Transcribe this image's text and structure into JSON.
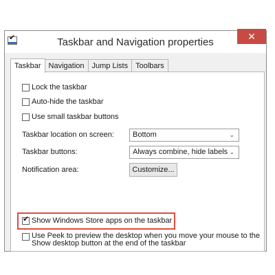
{
  "window": {
    "title": "Taskbar and Navigation properties",
    "close_glyph": "✕"
  },
  "tabs": [
    {
      "label": "Taskbar",
      "active": true
    },
    {
      "label": "Navigation",
      "active": false
    },
    {
      "label": "Jump Lists",
      "active": false
    },
    {
      "label": "Toolbars",
      "active": false
    }
  ],
  "taskbar": {
    "lock": {
      "label": "Lock the taskbar",
      "checked": false
    },
    "autohide": {
      "label": "Auto-hide the taskbar",
      "checked": false
    },
    "small_buttons": {
      "label": "Use small taskbar buttons",
      "checked": false
    },
    "location": {
      "label": "Taskbar location on screen:",
      "value": "Bottom"
    },
    "buttons": {
      "label": "Taskbar buttons:",
      "value": "Always combine, hide labels"
    },
    "notification": {
      "label": "Notification area:",
      "button": "Customize..."
    },
    "store_apps": {
      "label": "Show Windows Store apps on the taskbar",
      "checked": true
    },
    "peek": {
      "line1": "Use Peek to preview the desktop when you move your mouse to the",
      "line2": "Show desktop button at the end of the taskbar",
      "checked": false
    }
  },
  "icons": {
    "check_glyph": "✔",
    "chevron_glyph": "⌄"
  },
  "colors": {
    "highlight": "#e04a3c",
    "close_button": "#c74b44"
  }
}
